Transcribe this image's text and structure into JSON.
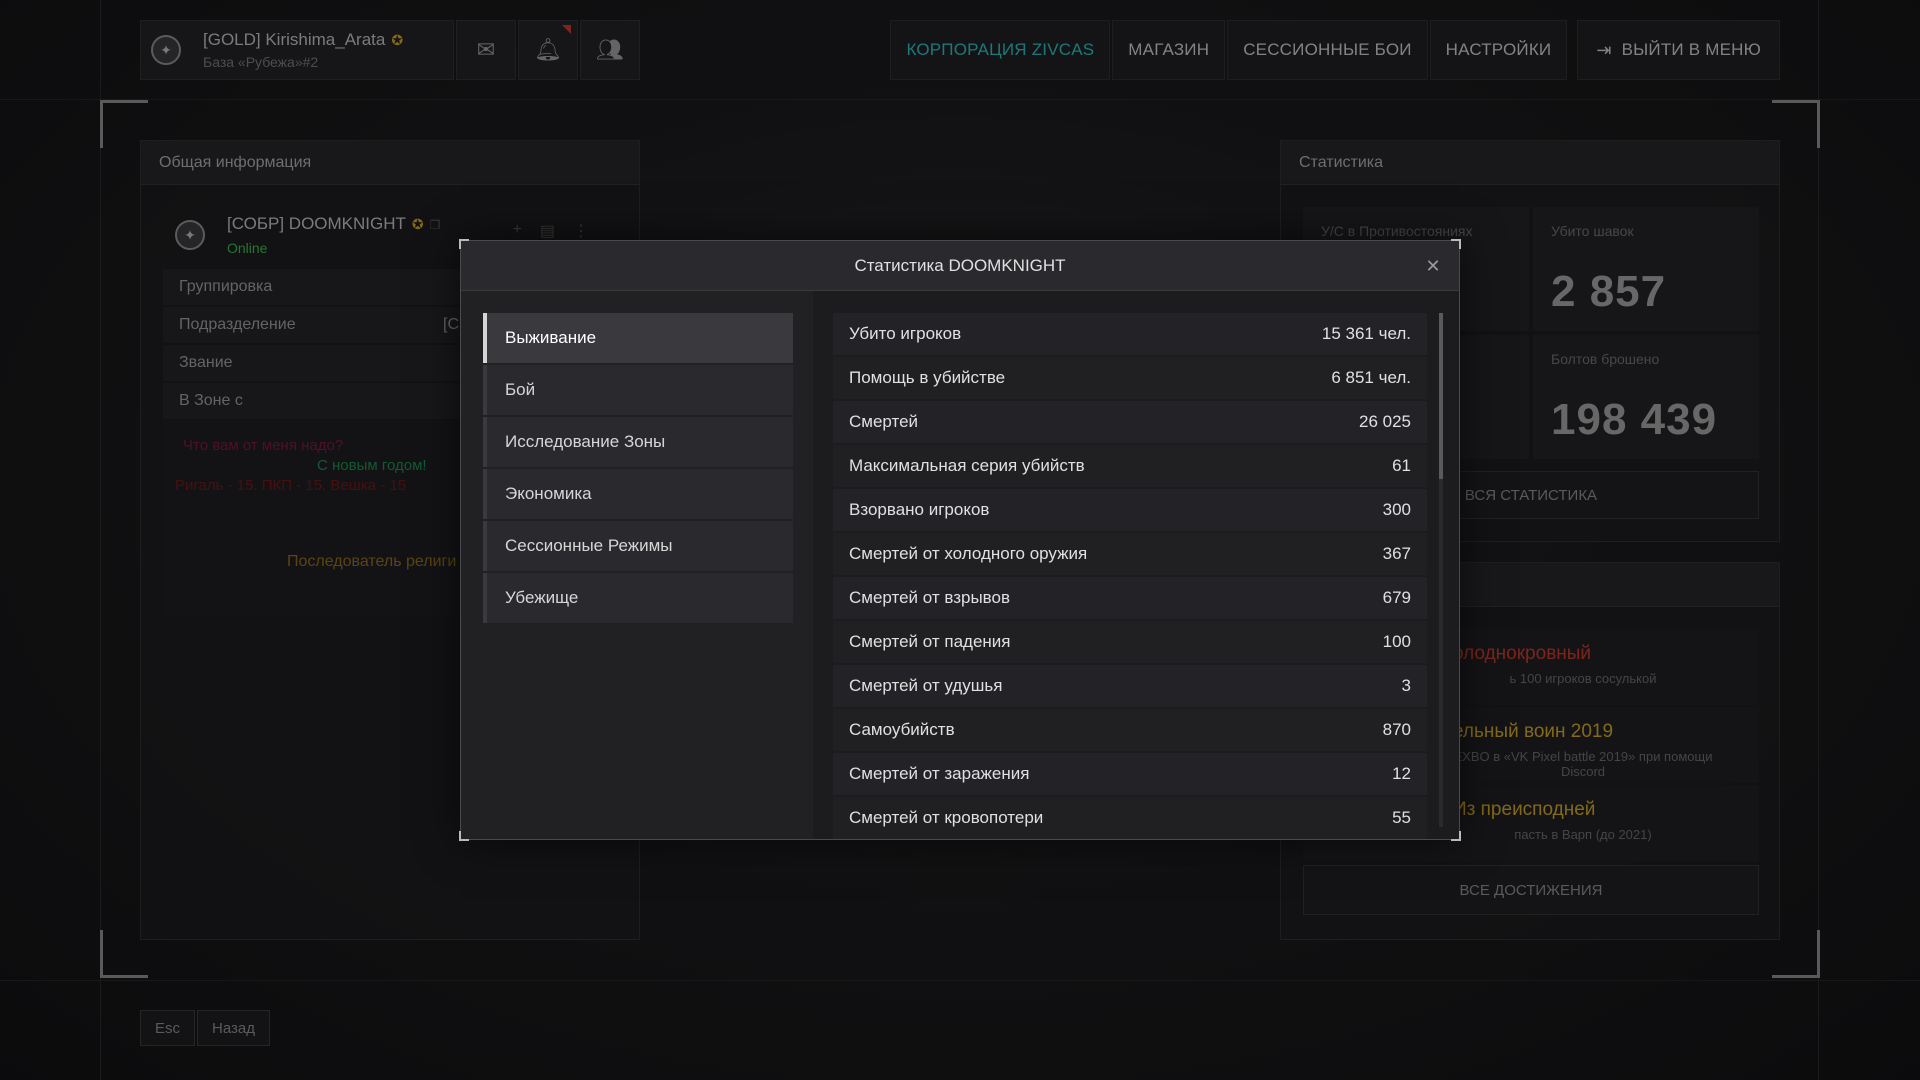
{
  "topbar": {
    "profile_name": "[GOLD] Kirishima_Arata",
    "profile_badge": "✪",
    "profile_sub": "База «Рубежа»#2",
    "icons": [
      "mail-icon",
      "bell-icon",
      "friends-icon"
    ],
    "nav": [
      {
        "label": "КОРПОРАЦИЯ ZIVCAS",
        "active": true
      },
      {
        "label": "МАГАЗИН"
      },
      {
        "label": "СЕССИОННЫЕ БОИ"
      },
      {
        "label": "НАСТРОЙКИ"
      }
    ],
    "exit_label": "ВЫЙТИ В МЕНЮ",
    "accent_color": "#2fb8b8"
  },
  "left_panel": {
    "title": "Общая информация",
    "player_name": "[СОБР] DOOMKNIGHT",
    "player_badge": "✪",
    "player_status": "Online",
    "rows": [
      {
        "label": "Группировка",
        "value": ""
      },
      {
        "label": "Подразделение",
        "value": "[С"
      },
      {
        "label": "Звание",
        "value": ""
      },
      {
        "label": "В Зоне с",
        "value": ""
      }
    ],
    "status_lines": [
      "Что вам от меня надо?",
      "С новым годом!",
      "Ригаль - 15. ПКП - 15. Вешка - 15",
      "Последователь религи"
    ]
  },
  "right_panel": {
    "title": "Статистика",
    "tiles": [
      {
        "label": "У/С в Противостояниях",
        "value": ""
      },
      {
        "label": "Убито шавок",
        "value": "2 857"
      },
      {
        "label": "",
        "value": ""
      },
      {
        "label": "Болтов брошено",
        "value": "198 439"
      }
    ],
    "all_stats_label": "ВСЯ СТАТИСТИКА"
  },
  "achievements": {
    "items": [
      {
        "title": "олоднокровный",
        "desc": "ь 100 игроков сосулькой",
        "color": "#c0392b"
      },
      {
        "title": "ельный воин 2019",
        "desc": "EXBO в «VK Pixel battle 2019» при помощи Discord",
        "color": "#c9a227"
      },
      {
        "title": "Из преисподней",
        "desc": "пасть в Варп (до 2021)",
        "color": "#c9a227"
      }
    ],
    "all_label": "ВСЕ ДОСТИЖЕНИЯ"
  },
  "bottom": {
    "esc_label": "Esc",
    "back_label": "Назад"
  },
  "modal": {
    "title": "Статистика DOOMKNIGHT",
    "categories": [
      {
        "label": "Выживание",
        "active": true
      },
      {
        "label": "Бой"
      },
      {
        "label": "Исследование Зоны"
      },
      {
        "label": "Экономика"
      },
      {
        "label": "Сессионные Режимы"
      },
      {
        "label": "Убежище"
      }
    ],
    "stats": [
      {
        "label": "Убито игроков",
        "value": "15 361 чел."
      },
      {
        "label": "Помощь в убийстве",
        "value": "6 851 чел."
      },
      {
        "label": "Смертей",
        "value": "26 025"
      },
      {
        "label": "Максимальная серия убийств",
        "value": "61"
      },
      {
        "label": "Взорвано игроков",
        "value": "300"
      },
      {
        "label": "Смертей от холодного оружия",
        "value": "367"
      },
      {
        "label": "Смертей от взрывов",
        "value": "679"
      },
      {
        "label": "Смертей от падения",
        "value": "100"
      },
      {
        "label": "Смертей от удушья",
        "value": "3"
      },
      {
        "label": "Самоубийств",
        "value": "870"
      },
      {
        "label": "Смертей от заражения",
        "value": "12"
      },
      {
        "label": "Смертей от кровопотери",
        "value": "55"
      }
    ]
  }
}
